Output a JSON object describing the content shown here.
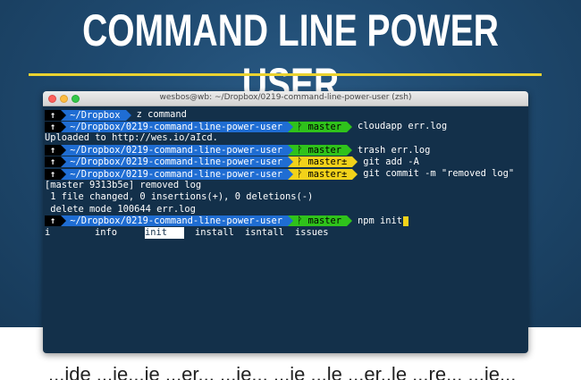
{
  "hero": {
    "title": "COMMAND LINE POWER USER",
    "accent_color": "#e9d230",
    "background_color": "#1f4a70"
  },
  "window": {
    "title": "wesbos@wb: ~/Dropbox/0219-command-line-power-user (zsh)",
    "traffic_lights": [
      "close",
      "minimize",
      "zoom"
    ]
  },
  "terminal": {
    "colors": {
      "background": "#13304a",
      "path_segment": "#1f6dd3",
      "git_clean": "#2fc21b",
      "git_dirty": "#f2d21a"
    },
    "lines": [
      {
        "arrow": "↑",
        "path": "~/Dropbox",
        "branch": "",
        "cmd": "z command"
      },
      {
        "arrow": "↑",
        "path": "~/Dropbox/0219-command-line-power-user",
        "branch": "ᚹ master",
        "cmd": "cloudapp err.log"
      },
      {
        "output": "Uploaded to http://wes.io/aIcd."
      },
      {
        "arrow": "↑",
        "path": "~/Dropbox/0219-command-line-power-user",
        "branch": "ᚹ master",
        "cmd": "trash err.log"
      },
      {
        "arrow": "↑",
        "path": "~/Dropbox/0219-command-line-power-user",
        "branch": "ᚹ master±",
        "cmd": "git add -A"
      },
      {
        "arrow": "↑",
        "path": "~/Dropbox/0219-command-line-power-user",
        "branch": "ᚹ master±",
        "cmd": "git commit -m \"removed log\""
      },
      {
        "output": "[master 9313b5e] removed log"
      },
      {
        "output": " 1 file changed, 0 insertions(+), 0 deletions(-)"
      },
      {
        "output": " delete mode 100644 err.log"
      },
      {
        "arrow": "↑",
        "path": "~/Dropbox/0219-command-line-power-user",
        "branch": "ᚹ master",
        "cmd": "npm init"
      }
    ],
    "completions": [
      "i",
      "info",
      "init",
      "install",
      "isntall",
      "issues"
    ],
    "selected_completion": "init"
  },
  "bottom": {
    "text": "...ide ...ie...ie ...er... ...ie... ...ie ...le ...er..le ...re... ...ie..."
  }
}
